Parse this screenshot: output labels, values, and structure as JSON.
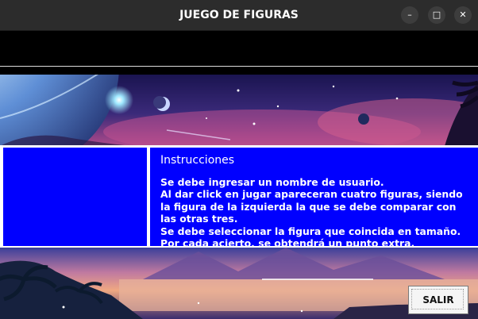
{
  "window": {
    "title": "JUEGO DE FIGURAS",
    "minimize_label": "–",
    "maximize_label": "□",
    "close_label": "✕"
  },
  "instructions": {
    "heading": "Instrucciones",
    "lines": [
      "Se debe ingresar un nombre de usuario.",
      "Al dar click en jugar apareceran cuatro figuras, siendo",
      "la figura de la izquierda la que se debe comparar con",
      "las otras tres.",
      "Se debe seleccionar la figura que coincida en tamaño.",
      "Por cada acierto, se obtendrá un punto extra."
    ]
  },
  "buttons": {
    "exit_label": "SALIR"
  },
  "colors": {
    "panel_blue": "#0000ff",
    "titlebar": "#2c2c2c"
  }
}
